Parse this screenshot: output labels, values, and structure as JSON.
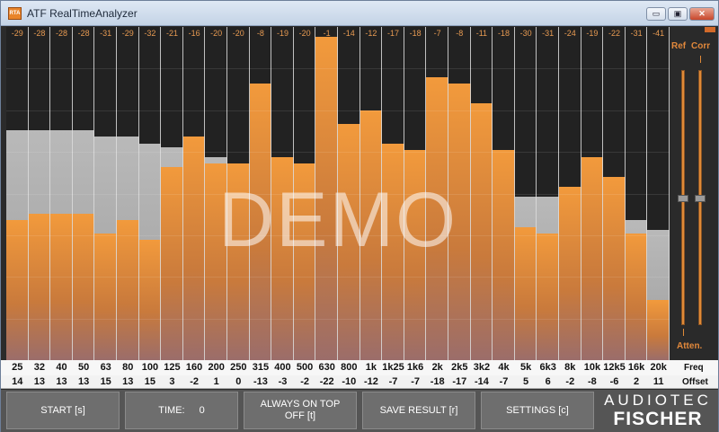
{
  "window": {
    "title": "ATF RealTimeAnalyzer",
    "icon_text": "RTA",
    "minimize_label": "▭",
    "restore_label": "▣",
    "close_label": "✕"
  },
  "colors": {
    "bar": "#f29a3c",
    "reference": "#b0b0b0",
    "background": "#222222",
    "accent": "#e1883b"
  },
  "bands": [
    {
      "freq": "25",
      "peak": "-29",
      "diff": "14",
      "level": 0.42,
      "ref": 0.69
    },
    {
      "freq": "32",
      "peak": "-28",
      "diff": "13",
      "level": 0.44,
      "ref": 0.69
    },
    {
      "freq": "40",
      "peak": "-28",
      "diff": "13",
      "level": 0.44,
      "ref": 0.69
    },
    {
      "freq": "50",
      "peak": "-28",
      "diff": "13",
      "level": 0.44,
      "ref": 0.69
    },
    {
      "freq": "63",
      "peak": "-31",
      "diff": "15",
      "level": 0.38,
      "ref": 0.67
    },
    {
      "freq": "80",
      "peak": "-29",
      "diff": "13",
      "level": 0.42,
      "ref": 0.67
    },
    {
      "freq": "100",
      "peak": "-32",
      "diff": "15",
      "level": 0.36,
      "ref": 0.65
    },
    {
      "freq": "125",
      "peak": "-21",
      "diff": "3",
      "level": 0.58,
      "ref": 0.64
    },
    {
      "freq": "160",
      "peak": "-16",
      "diff": "-2",
      "level": 0.67,
      "ref": 0.62
    },
    {
      "freq": "200",
      "peak": "-20",
      "diff": "1",
      "level": 0.59,
      "ref": 0.61
    },
    {
      "freq": "250",
      "peak": "-20",
      "diff": "0",
      "level": 0.59,
      "ref": 0.59
    },
    {
      "freq": "315",
      "peak": "-8",
      "diff": "-13",
      "level": 0.83,
      "ref": 0.58
    },
    {
      "freq": "400",
      "peak": "-19",
      "diff": "-3",
      "level": 0.61,
      "ref": 0.57
    },
    {
      "freq": "500",
      "peak": "-20",
      "diff": "-2",
      "level": 0.59,
      "ref": 0.55
    },
    {
      "freq": "630",
      "peak": "-1",
      "diff": "-22",
      "level": 0.97,
      "ref": 0.54
    },
    {
      "freq": "800",
      "peak": "-14",
      "diff": "-10",
      "level": 0.71,
      "ref": 0.52
    },
    {
      "freq": "1k",
      "peak": "-12",
      "diff": "-12",
      "level": 0.75,
      "ref": 0.51
    },
    {
      "freq": "1k25",
      "peak": "-17",
      "diff": "-7",
      "level": 0.65,
      "ref": 0.5
    },
    {
      "freq": "1k6",
      "peak": "-18",
      "diff": "-7",
      "level": 0.63,
      "ref": 0.5
    },
    {
      "freq": "2k",
      "peak": "-7",
      "diff": "-18",
      "level": 0.85,
      "ref": 0.5
    },
    {
      "freq": "2k5",
      "peak": "-8",
      "diff": "-17",
      "level": 0.83,
      "ref": 0.5
    },
    {
      "freq": "3k2",
      "peak": "-11",
      "diff": "-14",
      "level": 0.77,
      "ref": 0.5
    },
    {
      "freq": "4k",
      "peak": "-18",
      "diff": "-7",
      "level": 0.63,
      "ref": 0.5
    },
    {
      "freq": "5k",
      "peak": "-30",
      "diff": "5",
      "level": 0.4,
      "ref": 0.49
    },
    {
      "freq": "6k3",
      "peak": "-31",
      "diff": "6",
      "level": 0.38,
      "ref": 0.49
    },
    {
      "freq": "8k",
      "peak": "-24",
      "diff": "-2",
      "level": 0.52,
      "ref": 0.48
    },
    {
      "freq": "10k",
      "peak": "-19",
      "diff": "-8",
      "level": 0.61,
      "ref": 0.47
    },
    {
      "freq": "12k5",
      "peak": "-22",
      "diff": "-6",
      "level": 0.55,
      "ref": 0.46
    },
    {
      "freq": "16k",
      "peak": "-31",
      "diff": "2",
      "level": 0.38,
      "ref": 0.42
    },
    {
      "freq": "20k",
      "peak": "-41",
      "diff": "11",
      "level": 0.18,
      "ref": 0.39
    }
  ],
  "overlay": {
    "demo_text": "DEMO"
  },
  "sliders": {
    "ref_label": "Ref",
    "corr_label": "Corr",
    "atten_label": "Atten.",
    "ref_level": 0.5,
    "corr_level": 0.5
  },
  "rows": {
    "freq_label": "Freq",
    "offset_label": "Offset"
  },
  "buttons": {
    "start": "START [s]",
    "time_label": "TIME:",
    "time_value": "0",
    "always_on_top": "ALWAYS ON TOP",
    "always_on_top_state": "OFF [t]",
    "save": "SAVE RESULT [r]",
    "settings": "SETTINGS [c]"
  },
  "brand": {
    "line1": "AUDIOTEC",
    "line2": "FISCHER"
  }
}
